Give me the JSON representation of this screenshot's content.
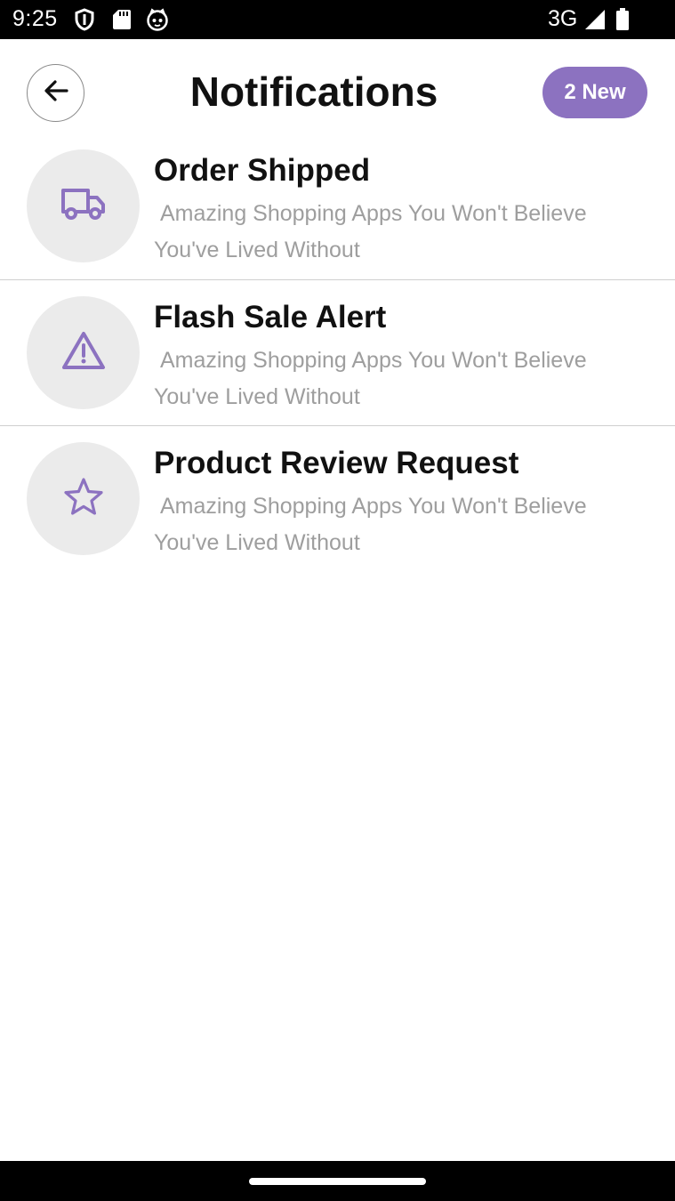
{
  "status_bar": {
    "time": "9:25",
    "network": "3G",
    "icons": [
      "shield-icon",
      "sd-card-icon",
      "cat-icon",
      "signal-icon",
      "battery-icon"
    ]
  },
  "header": {
    "title": "Notifications",
    "badge": "2 New",
    "back_icon": "arrow-left-icon"
  },
  "colors": {
    "accent": "#8c72c0",
    "icon_circle": "#ebebeb",
    "body_text": "#9e9e9e"
  },
  "notifications": [
    {
      "icon": "truck-icon",
      "title": "Order Shipped",
      "body": " Amazing Shopping Apps You Won't Believe You've Lived Without"
    },
    {
      "icon": "warning-icon",
      "title": "Flash Sale Alert",
      "body": " Amazing Shopping Apps You Won't Believe You've Lived Without"
    },
    {
      "icon": "star-icon",
      "title": "Product Review Request",
      "body": " Amazing Shopping Apps You Won't Believe You've Lived Without"
    }
  ]
}
